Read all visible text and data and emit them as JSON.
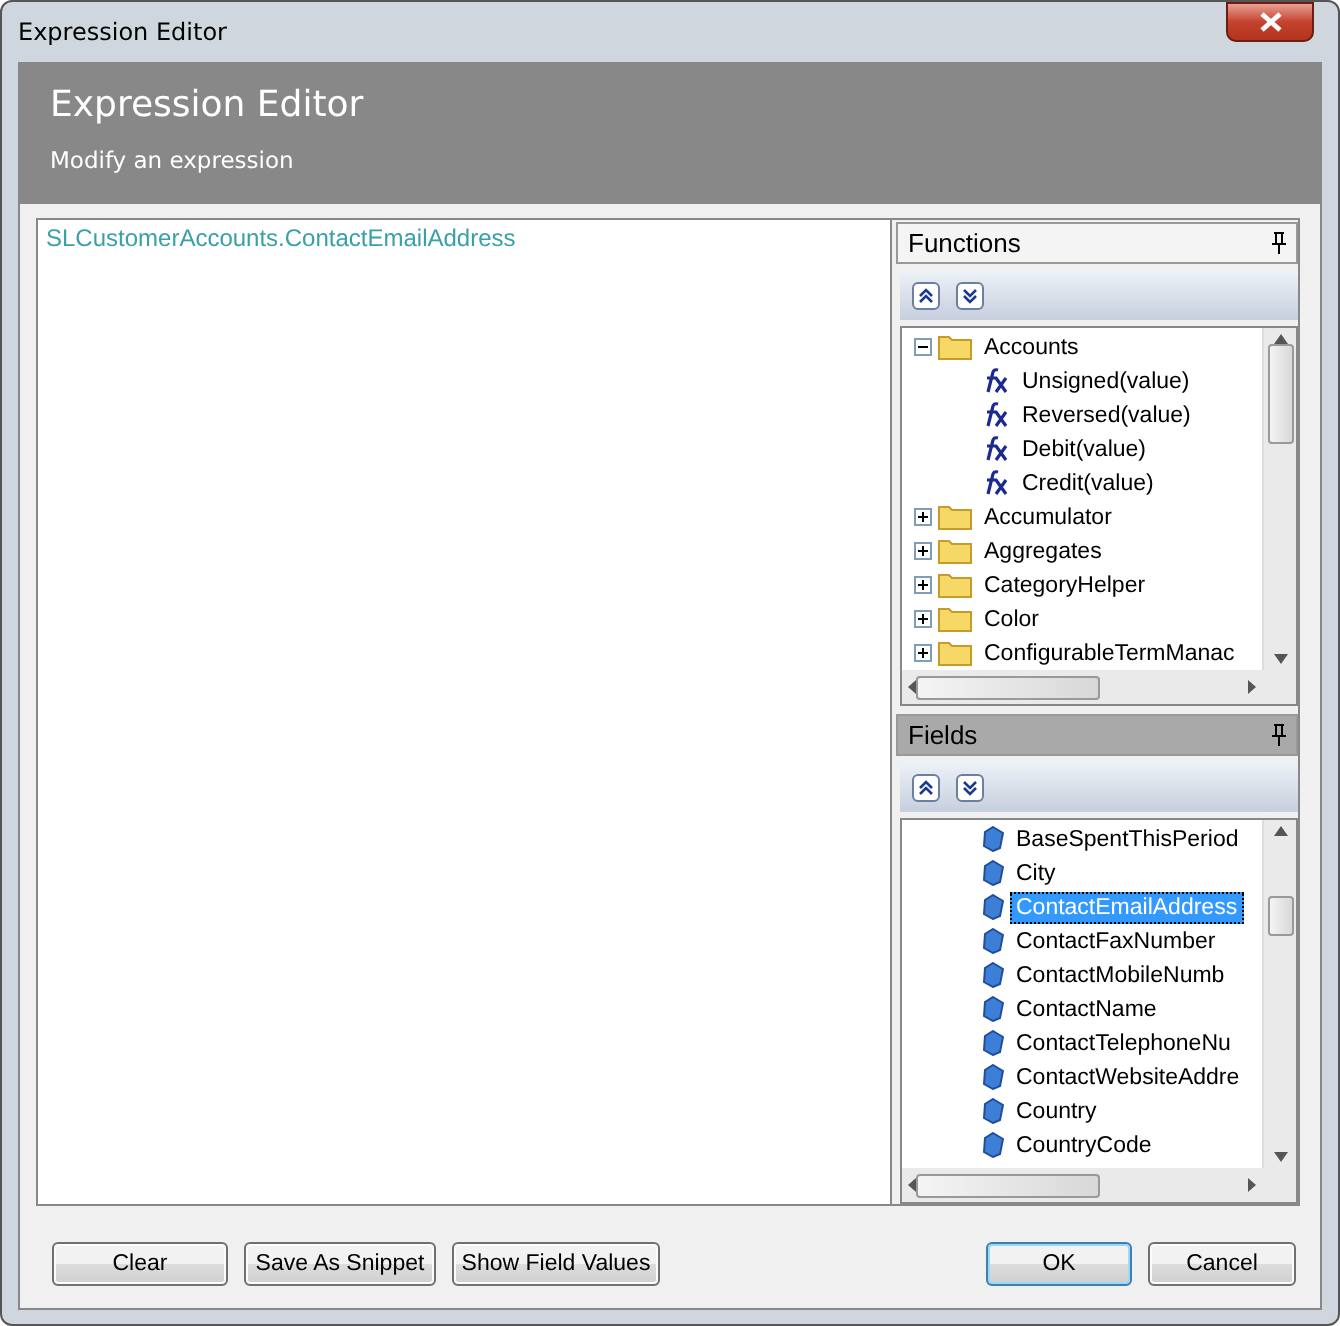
{
  "window": {
    "title": "Expression Editor"
  },
  "header": {
    "title": "Expression Editor",
    "subtitle": "Modify an expression"
  },
  "editor": {
    "value": "SLCustomerAccounts.ContactEmailAddress"
  },
  "functions": {
    "title": "Functions",
    "items": [
      {
        "kind": "folder",
        "label": "Accounts",
        "expanded": true,
        "children": [
          {
            "kind": "function",
            "label": "Unsigned(value)"
          },
          {
            "kind": "function",
            "label": "Reversed(value)"
          },
          {
            "kind": "function",
            "label": "Debit(value)"
          },
          {
            "kind": "function",
            "label": "Credit(value)"
          }
        ]
      },
      {
        "kind": "folder",
        "label": "Accumulator",
        "expanded": false
      },
      {
        "kind": "folder",
        "label": "Aggregates",
        "expanded": false
      },
      {
        "kind": "folder",
        "label": "CategoryHelper",
        "expanded": false
      },
      {
        "kind": "folder",
        "label": "Color",
        "expanded": false
      },
      {
        "kind": "folder",
        "label": "ConfigurableTermManac",
        "expanded": false
      }
    ]
  },
  "fields": {
    "title": "Fields",
    "items": [
      {
        "label": "BaseSpentThisPeriod",
        "selected": false
      },
      {
        "label": "City",
        "selected": false
      },
      {
        "label": "ContactEmailAddress",
        "selected": true
      },
      {
        "label": "ContactFaxNumber",
        "selected": false
      },
      {
        "label": "ContactMobileNumb",
        "selected": false
      },
      {
        "label": "ContactName",
        "selected": false
      },
      {
        "label": "ContactTelephoneNu",
        "selected": false
      },
      {
        "label": "ContactWebsiteAddre",
        "selected": false
      },
      {
        "label": "Country",
        "selected": false
      },
      {
        "label": "CountryCode",
        "selected": false
      }
    ]
  },
  "buttons_left": [
    {
      "label": "Clear",
      "default": false
    },
    {
      "label": "Save As Snippet",
      "default": false
    },
    {
      "label": "Show Field Values",
      "default": false
    }
  ],
  "buttons_right": [
    {
      "label": "OK",
      "default": true
    },
    {
      "label": "Cancel",
      "default": false
    }
  ]
}
